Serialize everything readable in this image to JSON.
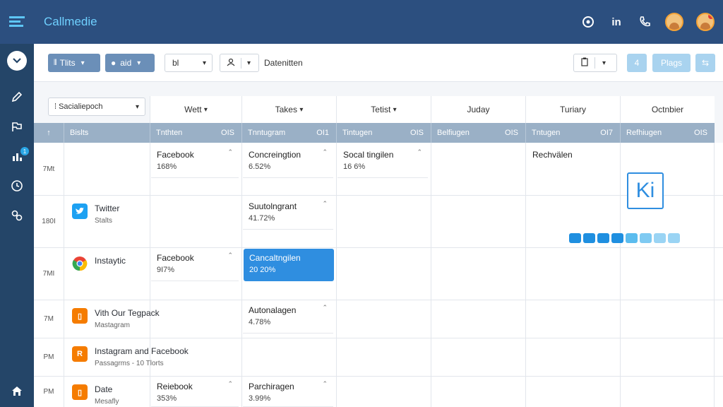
{
  "app": {
    "title": "Callmedie"
  },
  "toolbar": {
    "btn1": "Tlits",
    "btn2": "aid",
    "select1": "bl",
    "label": "Datenitten",
    "btn_right1": "4",
    "btn_right2": "Plags"
  },
  "grid": {
    "select": "Sacialiepoch",
    "columns": [
      "Wett",
      "Takes",
      "Tetist",
      "Juday",
      "Turiary",
      "Octnbier"
    ],
    "subheads": [
      {
        "left": "Bislts",
        "right": ""
      },
      {
        "left": "Tnthten",
        "right": "OIS"
      },
      {
        "left": "Tnntugram",
        "right": "OI1"
      },
      {
        "left": "Tintugen",
        "right": "OIS"
      },
      {
        "left": "Belfiugen",
        "right": "OIS"
      },
      {
        "left": "Tntugen",
        "right": "OI7"
      },
      {
        "left": "Refhiugen",
        "right": "OIS"
      }
    ],
    "times": [
      "7Mt",
      "180I",
      "7MI",
      "7M",
      "PM",
      "PM"
    ],
    "sources": [
      {
        "title": "Twitter",
        "sub": "Stalts",
        "icon": "twitter-icon",
        "color": "#1da1f2"
      },
      {
        "title": "Instaytic",
        "sub": "",
        "icon": "chrome-icon",
        "color": "#ea4335"
      },
      {
        "title": "Vith Our Tegpack",
        "sub": "Mastagram",
        "icon": "orange-app-icon",
        "color": "#f57c00"
      },
      {
        "title": "Instagram and Facebook",
        "sub": "Passagrms - 10 Tlorts",
        "icon": "orange-app-icon",
        "color": "#f57c00"
      },
      {
        "title": "Date",
        "sub": "Mesafly",
        "icon": "orange-app-icon",
        "color": "#f57c00"
      }
    ],
    "cards": {
      "r1c1": {
        "title": "Facebook",
        "sub": "168%"
      },
      "r1c2": {
        "title": "Concreingtion",
        "sub": "6.52%"
      },
      "r1c3": {
        "title": "Socal tingilen",
        "sub": "16 6%"
      },
      "r1c6": {
        "title": "Rechvälen"
      },
      "r2c2": {
        "title": "Suutolngrant",
        "sub": "41.72%"
      },
      "r3c1": {
        "title": "Facebook",
        "sub": "9I7%"
      },
      "r3c2": {
        "title": "Cancaltngilen",
        "sub": "20 20%"
      },
      "r4c2": {
        "title": "Autonalagen",
        "sub": "4.78%"
      },
      "r6c1": {
        "title": "Reiebook",
        "sub": "353%"
      },
      "r6c2": {
        "title": "Parchiragen",
        "sub": "3.99%"
      }
    },
    "ki_text": "Ki"
  },
  "progress_colors": [
    "#1f8fe0",
    "#1f8fe0",
    "#1f8fe0",
    "#1f8fe0",
    "#5bbcee",
    "#7fcaf2",
    "#9ad4f4",
    "#9ad4f4"
  ]
}
